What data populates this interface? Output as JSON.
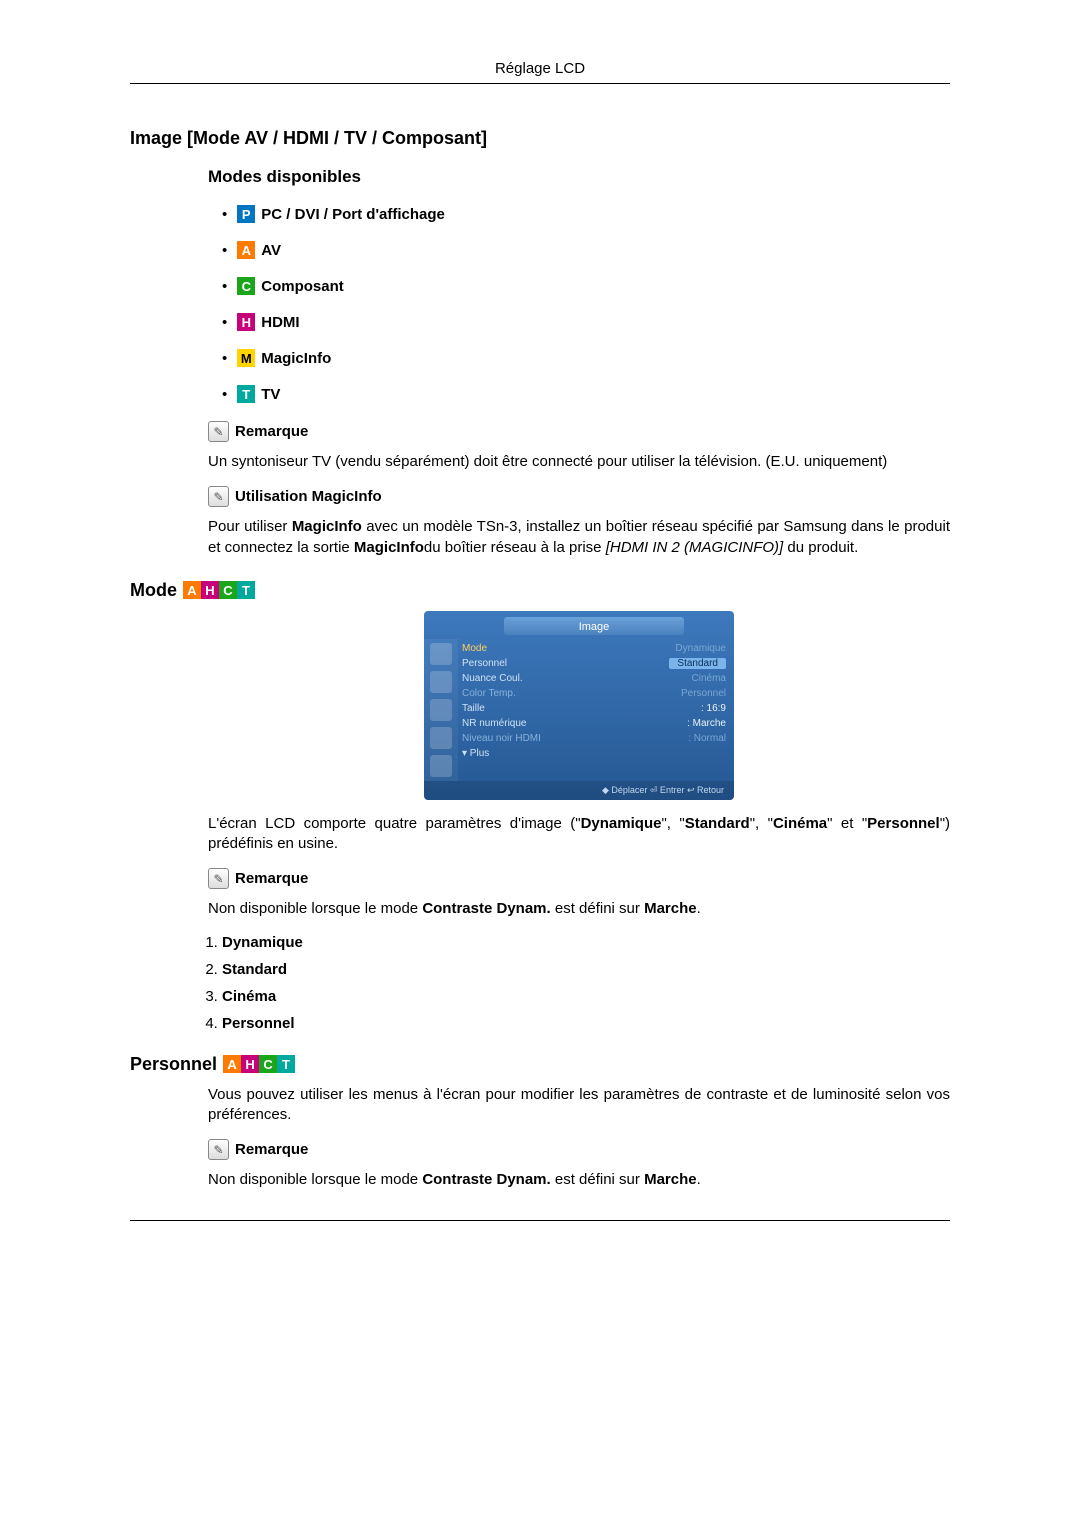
{
  "header": {
    "title": "Réglage LCD"
  },
  "section1": {
    "title": "Image [Mode AV / HDMI / TV / Composant]",
    "modes_title": "Modes disponibles",
    "modes": [
      {
        "badge": "P",
        "cls": "badge-p",
        "label": "PC / DVI / Port d'affichage"
      },
      {
        "badge": "A",
        "cls": "badge-a",
        "label": "AV"
      },
      {
        "badge": "C",
        "cls": "badge-c",
        "label": "Composant"
      },
      {
        "badge": "H",
        "cls": "badge-h",
        "label": "HDMI"
      },
      {
        "badge": "M",
        "cls": "badge-m",
        "label": "MagicInfo"
      },
      {
        "badge": "T",
        "cls": "badge-t",
        "label": "TV"
      }
    ],
    "note1_label": "Remarque",
    "note1_text": "Un syntoniseur TV (vendu séparément) doit être connecté pour utiliser la télévision. (E.U. uniquement)",
    "note2_label": "Utilisation MagicInfo",
    "note2": {
      "p1": "Pour utiliser ",
      "b1": "MagicInfo",
      "p2": " avec un modèle TSn-3, installez un boîtier réseau spécifié par Samsung dans le produit et connectez la sortie ",
      "b2": "MagicInfo",
      "p3": "du boîtier réseau à la prise ",
      "i1": "[HDMI IN 2 (MAGICINFO)]",
      "p4": " du produit."
    }
  },
  "section_mode": {
    "title": "Mode",
    "badges": [
      "A",
      "H",
      "C",
      "T"
    ],
    "osd": {
      "title": "Image",
      "rows": [
        {
          "l": "Mode",
          "lhl": true,
          "r": "Dynamique",
          "rdim": true
        },
        {
          "l": "Personnel",
          "r": "Standard",
          "rbox": true
        },
        {
          "l": "Nuance Coul.",
          "r": "Cinéma",
          "rdim": true
        },
        {
          "l": "Color Temp.",
          "ldim": true,
          "r": "Personnel",
          "rdim": true
        },
        {
          "l": "Taille",
          "r": ": 16:9"
        },
        {
          "l": "NR numérique",
          "r": ": Marche"
        },
        {
          "l": "Niveau noir HDMI",
          "ldim": true,
          "r": ": Normal",
          "rdim": true
        },
        {
          "l": "▾ Plus",
          "r": ""
        }
      ],
      "foot": "◆ Déplacer   ⏎ Entrer   ↩ Retour"
    },
    "desc": {
      "p1": "L'écran LCD comporte quatre paramètres d'image (\"",
      "b1": "Dynamique",
      "p2": "\", \"",
      "b2": "Standard",
      "p3": "\", \"",
      "b3": "Cinéma",
      "p4": "\" et \"",
      "b4": "Personnel",
      "p5": "\") prédéfinis en usine."
    },
    "note_label": "Remarque",
    "note": {
      "p1": "Non disponible lorsque le mode ",
      "b1": "Contraste Dynam.",
      "p2": " est défini sur ",
      "b2": "Marche",
      "p3": "."
    },
    "list": [
      "Dynamique",
      "Standard",
      "Cinéma",
      "Personnel"
    ]
  },
  "section_personnel": {
    "title": "Personnel",
    "badges": [
      "A",
      "H",
      "C",
      "T"
    ],
    "desc": "Vous pouvez utiliser les menus à l'écran pour modifier les paramètres de contraste et de luminosité selon vos préférences.",
    "note_label": "Remarque",
    "note": {
      "p1": "Non disponible lorsque le mode ",
      "b1": "Contraste Dynam.",
      "p2": " est défini sur ",
      "b2": "Marche",
      "p3": "."
    }
  }
}
